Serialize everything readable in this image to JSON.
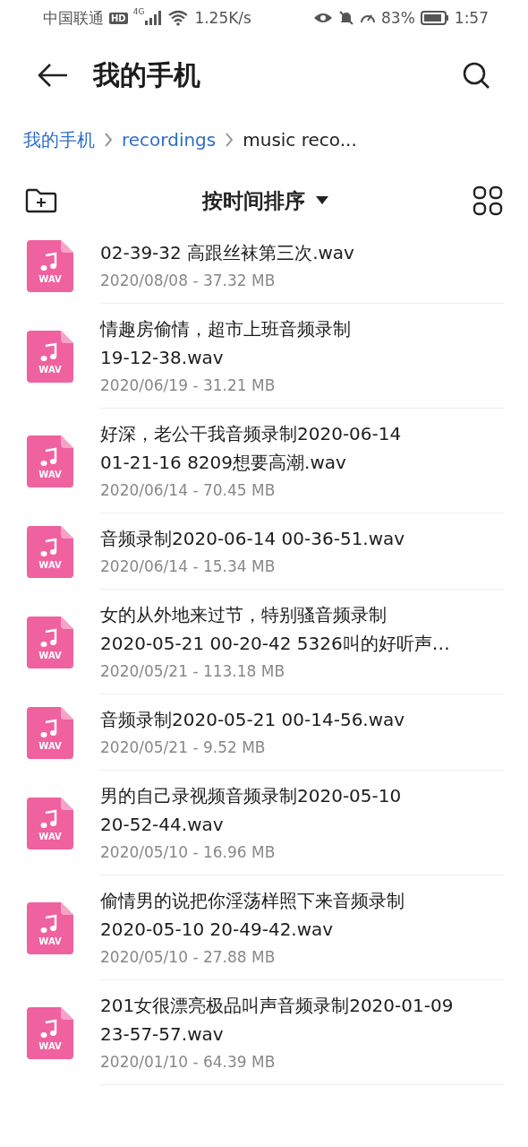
{
  "status_bar": {
    "carrier": "中国联通",
    "hd": "HD",
    "network": "4G",
    "speed": "1.25K/s",
    "battery": "83%",
    "time": "1:57"
  },
  "header": {
    "title": "我的手机"
  },
  "breadcrumb": [
    {
      "label": "我的手机",
      "current": false
    },
    {
      "label": "recordings",
      "current": false
    },
    {
      "label": "music reco...",
      "current": true
    }
  ],
  "toolbar": {
    "sort": "按时间排序"
  },
  "files": [
    {
      "lines": [
        "02-39-32  高跟丝袜第三次.wav"
      ],
      "meta": "2020/08/08 - 37.32 MB",
      "badge": "WAV"
    },
    {
      "lines": [
        "情趣房偷情，超市上班音频录制",
        "19-12-38.wav"
      ],
      "meta": "2020/06/19 - 31.21 MB",
      "badge": "WAV"
    },
    {
      "lines": [
        "好深，老公干我音频录制2020-06-14",
        "01-21-16  8209想要高潮.wav"
      ],
      "meta": "2020/06/14 - 70.45 MB",
      "badge": "WAV"
    },
    {
      "lines": [
        "音频录制2020-06-14 00-36-51.wav"
      ],
      "meta": "2020/06/14 - 15.34 MB",
      "badge": "WAV"
    },
    {
      "lines": [
        "女的从外地来过节，特别骚音频录制",
        "2020-05-21 00-20-42   5326叫的好听声…"
      ],
      "meta": "2020/05/21 - 113.18 MB",
      "badge": "WAV"
    },
    {
      "lines": [
        "音频录制2020-05-21 00-14-56.wav"
      ],
      "meta": "2020/05/21 - 9.52 MB",
      "badge": "WAV"
    },
    {
      "lines": [
        "男的自己录视频音频录制2020-05-10",
        "20-52-44.wav"
      ],
      "meta": "2020/05/10 - 16.96 MB",
      "badge": "WAV"
    },
    {
      "lines": [
        "偷情男的说把你淫荡样照下来音频录制",
        "2020-05-10 20-49-42.wav"
      ],
      "meta": "2020/05/10 - 27.88 MB",
      "badge": "WAV"
    },
    {
      "lines": [
        "201女很漂亮极品叫声音频录制2020-01-09",
        "23-57-57.wav"
      ],
      "meta": "2020/01/10 - 64.39 MB",
      "badge": "WAV"
    }
  ]
}
